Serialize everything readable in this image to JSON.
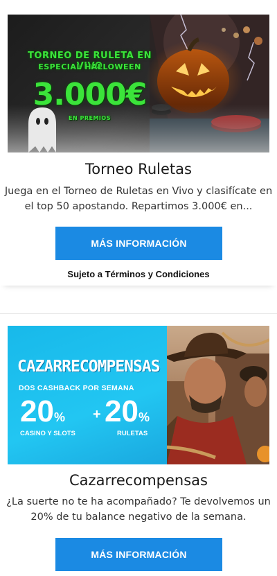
{
  "promos": [
    {
      "banner": {
        "line1": "TORNEO DE RULETA EN VIVO",
        "line2": "ESPECIAL HALLOWEEN",
        "amount": "3.000€",
        "sub": "EN PREMIOS"
      },
      "title": "Torneo Ruletas",
      "description": "Juega en el Torneo de Ruletas en Vivo y clasifícate en el top 50 apostando. Repartimos 3.000€ en...",
      "cta_label": "MÁS INFORMACIÓN",
      "terms": "Sujeto a Términos y Condiciones"
    },
    {
      "banner": {
        "title": "CAZARRECOMPENSAS",
        "sub": "DOS CASHBACK POR SEMANA",
        "pct1": "20",
        "pct2": "20",
        "pct_symbol": "%",
        "plus": "+",
        "label1": "CASINO Y SLOTS",
        "label2": "RULETAS"
      },
      "title": "Cazarrecompensas",
      "description": "¿La suerte no te ha acompañado? Te devolvemos un 20% de tu balance negativo de la semana.",
      "cta_label": "MÁS INFORMACIÓN"
    }
  ],
  "colors": {
    "cta": "#1b8ae3",
    "halloween_text": "#3be43a",
    "cashback_bg": "#22c6f2"
  }
}
